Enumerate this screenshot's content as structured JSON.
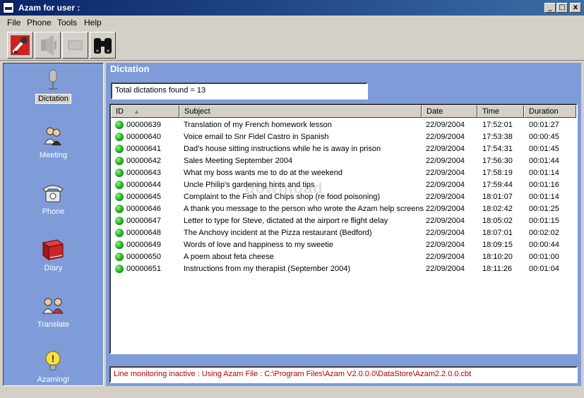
{
  "window": {
    "title": "Azam for user :",
    "minimize": "_",
    "maximize": "□",
    "close": "x"
  },
  "menu": [
    "File",
    "Phone",
    "Tools",
    "Help"
  ],
  "toolbar": [
    {
      "icon": "record-microphone-icon"
    },
    {
      "icon": "speaker-icon"
    },
    {
      "icon": "blank-icon"
    },
    {
      "icon": "binoculars-icon"
    }
  ],
  "sidebar": {
    "items": [
      {
        "label": "Dictation",
        "icon": "microphone-icon",
        "active": true
      },
      {
        "label": "Meeting",
        "icon": "people-icon",
        "active": false
      },
      {
        "label": "Phone",
        "icon": "telephone-icon",
        "active": false
      },
      {
        "label": "Diary",
        "icon": "book-icon",
        "active": false
      },
      {
        "label": "Translate",
        "icon": "translate-people-icon",
        "active": false
      },
      {
        "label": "Azaming!",
        "icon": "lightbulb-icon",
        "active": false
      }
    ]
  },
  "main": {
    "section_title": "Dictation",
    "count_text": "Total dictations found = 13",
    "columns": [
      "ID",
      "Subject",
      "Date",
      "Time",
      "Duration"
    ],
    "rows": [
      {
        "id": "00000639",
        "subject": "Translation of my French homework lesson",
        "date": "22/09/2004",
        "time": "17:52:01",
        "duration": "00:01:27"
      },
      {
        "id": "00000640",
        "subject": "Voice email to Snr Fidel Castro in Spanish",
        "date": "22/09/2004",
        "time": "17:53:38",
        "duration": "00:00:45"
      },
      {
        "id": "00000641",
        "subject": "Dad's house sitting instructions while he is away in prison",
        "date": "22/09/2004",
        "time": "17:54:31",
        "duration": "00:01:45"
      },
      {
        "id": "00000642",
        "subject": "Sales Meeting September 2004",
        "date": "22/09/2004",
        "time": "17:56:30",
        "duration": "00:01:44"
      },
      {
        "id": "00000643",
        "subject": "What my boss wants me to do at the weekend",
        "date": "22/09/2004",
        "time": "17:58:19",
        "duration": "00:01:14"
      },
      {
        "id": "00000644",
        "subject": "Uncle Philip's gardening hints and tips",
        "date": "22/09/2004",
        "time": "17:59:44",
        "duration": "00:01:16"
      },
      {
        "id": "00000645",
        "subject": "Complaint to the Fish and Chips shop (re food poisoning)",
        "date": "22/09/2004",
        "time": "18:01:07",
        "duration": "00:01:14"
      },
      {
        "id": "00000646",
        "subject": "A thank you message to the person who wrote the Azam help screens",
        "date": "22/09/2004",
        "time": "18:02:42",
        "duration": "00:01:25"
      },
      {
        "id": "00000647",
        "subject": "Letter to type for Steve, dictated at the airport re flight delay",
        "date": "22/09/2004",
        "time": "18:05:02",
        "duration": "00:01:15"
      },
      {
        "id": "00000648",
        "subject": "The Anchovy incident at the Pizza restaurant (Bedford)",
        "date": "22/09/2004",
        "time": "18:07:01",
        "duration": "00:02:02"
      },
      {
        "id": "00000649",
        "subject": "Words of love and happiness to my sweetie",
        "date": "22/09/2004",
        "time": "18:09:15",
        "duration": "00:00:44"
      },
      {
        "id": "00000650",
        "subject": "A poem about feta cheese",
        "date": "22/09/2004",
        "time": "18:10:20",
        "duration": "00:01:00"
      },
      {
        "id": "00000651",
        "subject": "Instructions from my therapist (September 2004)",
        "date": "22/09/2004",
        "time": "18:11:26",
        "duration": "00:01:04"
      }
    ],
    "watermark": "download",
    "status_text": "Line monitoring inactive : Using Azam File : C:\\Program Files\\Azam V2.0.0.0\\DataStore\\Azam2.2.0.0.cbt"
  },
  "colors": {
    "panel": "#7f9cd8",
    "status_text": "#b00000",
    "status_dot": "#2eb82e"
  }
}
